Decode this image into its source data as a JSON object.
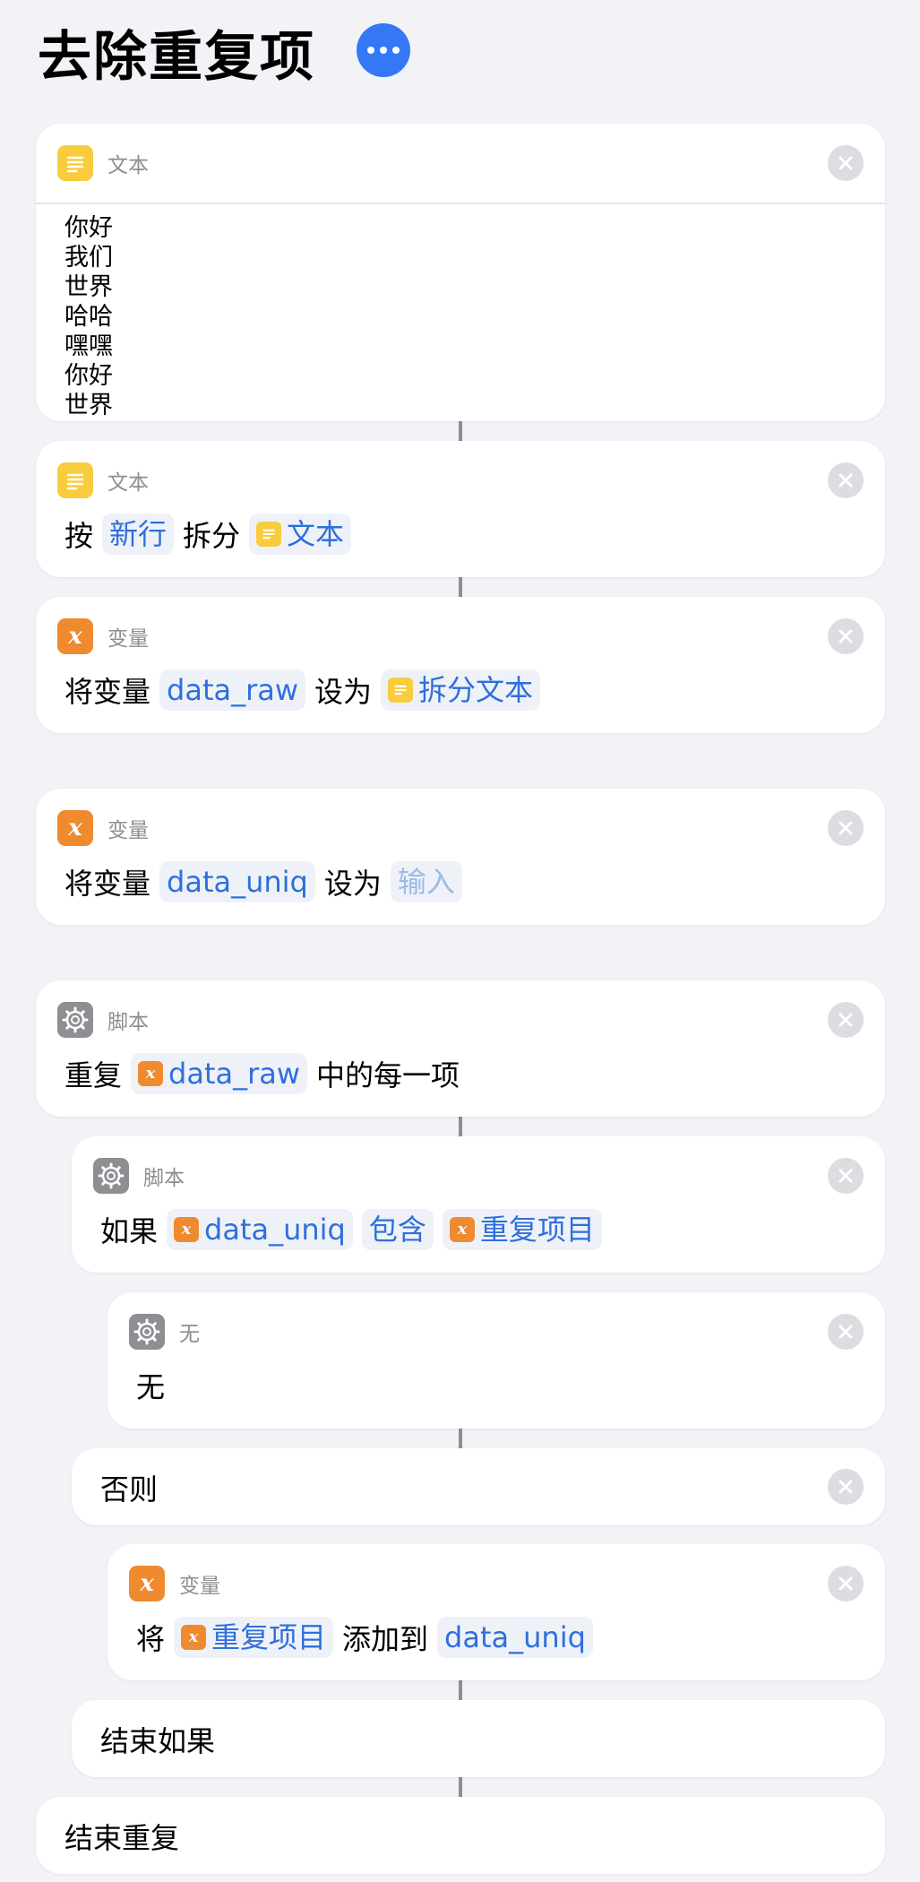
{
  "page": {
    "title": "去除重复项"
  },
  "colors": {
    "accent": "#3478f6",
    "text_icon": "#f8cc3c",
    "variable_icon": "#ef8a2f",
    "script_icon": "#8e8e93",
    "token_text": "#2f6fdb"
  },
  "actions": {
    "text1": {
      "category": "文本",
      "lines": [
        "你好",
        "我们",
        "世界",
        "哈哈",
        "嘿嘿",
        "你好",
        "世界"
      ]
    },
    "split": {
      "category": "文本",
      "w1": "按",
      "t1": "新行",
      "w2": "拆分",
      "t2": "文本"
    },
    "setvar1": {
      "category": "变量",
      "w1": "将变量",
      "t1": "data_raw",
      "w2": "设为",
      "t2": "拆分文本"
    },
    "setvar2": {
      "category": "变量",
      "w1": "将变量",
      "t1": "data_uniq",
      "w2": "设为",
      "t2_placeholder": "输入"
    },
    "repeat": {
      "category": "脚本",
      "w1": "重复",
      "t1": "data_raw",
      "w2": "中的每一项"
    },
    "if": {
      "category": "脚本",
      "w1": "如果",
      "t1": "data_uniq",
      "t2": "包含",
      "t3": "重复项目"
    },
    "nothing": {
      "category": "无",
      "label": "无"
    },
    "otherwise": {
      "label": "否则"
    },
    "add": {
      "category": "变量",
      "w1": "将",
      "t1": "重复项目",
      "w2": "添加到",
      "t2": "data_uniq"
    },
    "end_if": {
      "label": "结束如果"
    },
    "end_repeat": {
      "label": "结束重复"
    }
  }
}
